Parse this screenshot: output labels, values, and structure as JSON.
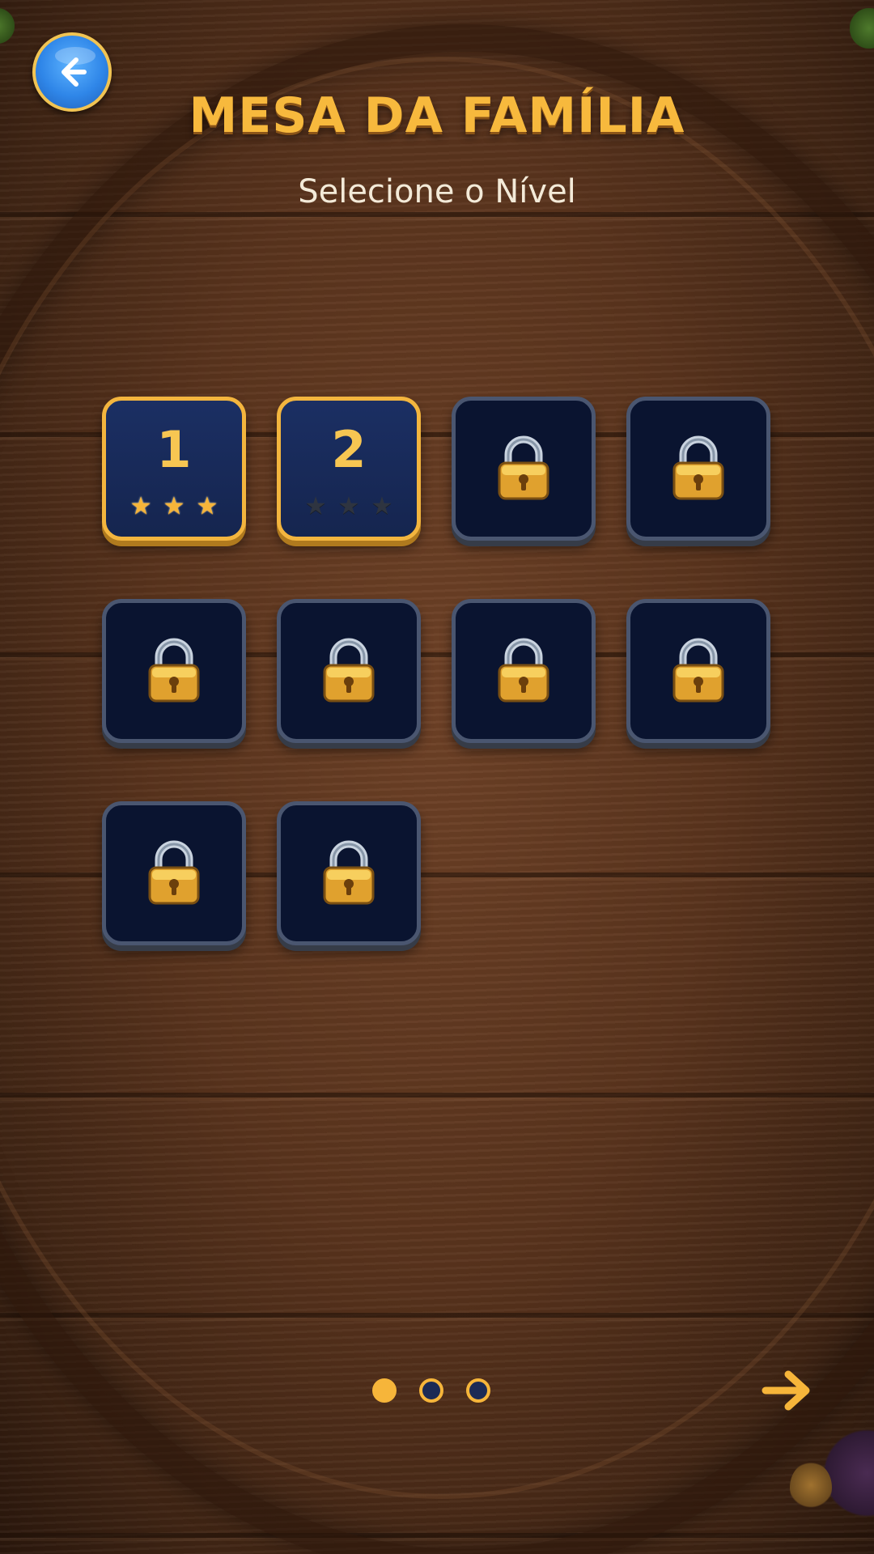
{
  "header": {
    "title": "MESA DA FAMÍLIA",
    "subtitle": "Selecione o Nível",
    "back_icon": "arrow-left-icon"
  },
  "colors": {
    "accent": "#f6b53a",
    "tile_unlocked_bg": "#1b2f63",
    "tile_locked_bg": "#0a1430",
    "back_button": "#2f86e8"
  },
  "levels": [
    {
      "label": "1",
      "locked": false,
      "stars_earned": 3,
      "stars_total": 3
    },
    {
      "label": "2",
      "locked": false,
      "stars_earned": 0,
      "stars_total": 3
    },
    {
      "label": "",
      "locked": true,
      "icon": "lock-icon"
    },
    {
      "label": "",
      "locked": true,
      "icon": "lock-icon"
    },
    {
      "label": "",
      "locked": true,
      "icon": "lock-icon"
    },
    {
      "label": "",
      "locked": true,
      "icon": "lock-icon"
    },
    {
      "label": "",
      "locked": true,
      "icon": "lock-icon"
    },
    {
      "label": "",
      "locked": true,
      "icon": "lock-icon"
    },
    {
      "label": "",
      "locked": true,
      "icon": "lock-icon"
    },
    {
      "label": "",
      "locked": true,
      "icon": "lock-icon"
    }
  ],
  "pagination": {
    "pages": 3,
    "current": 1,
    "next_icon": "arrow-right-icon"
  }
}
